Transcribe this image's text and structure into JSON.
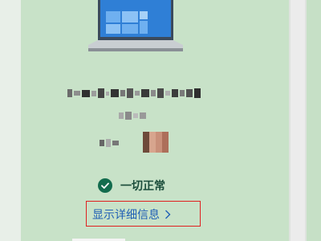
{
  "status": {
    "icon": "check-circle-icon",
    "text": "一切正常",
    "color": "#136c4e"
  },
  "details_link": {
    "label": "显示详细信息",
    "icon": "chevron-right-icon",
    "color": "#1f5fb5"
  },
  "illustration": {
    "icon": "laptop-icon"
  },
  "highlight_color": "#e02020"
}
